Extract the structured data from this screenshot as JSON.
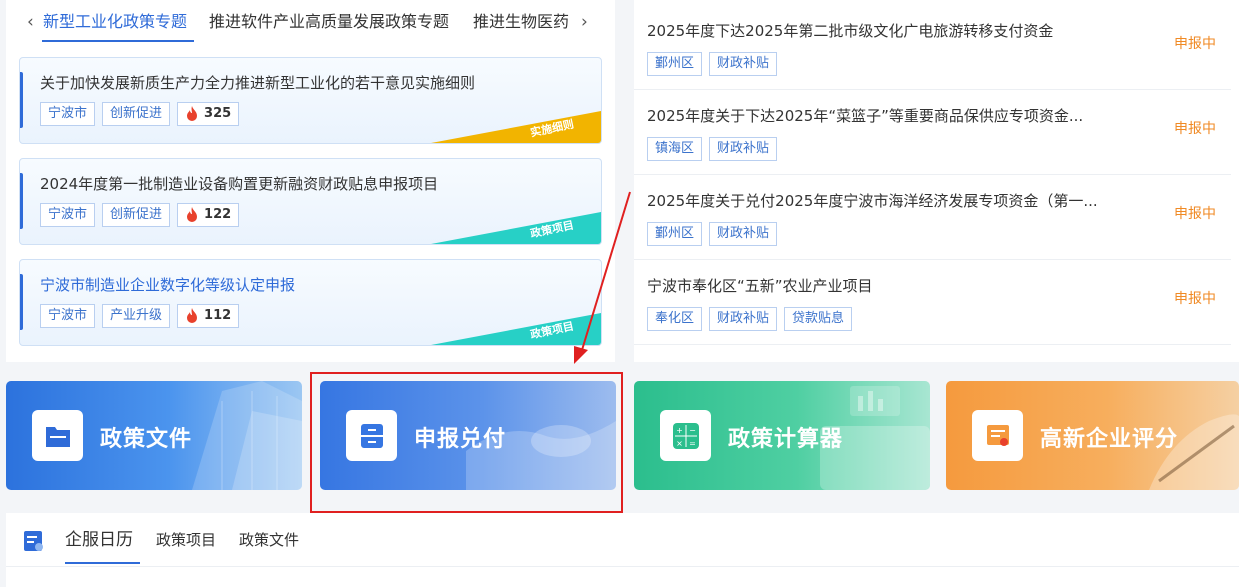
{
  "colors": {
    "brand_blue": "#2f6bd8",
    "status_orange": "#f08a24",
    "highlight_red": "#e02020",
    "ribbon_gold": "#f2b400",
    "ribbon_teal": "#27d0c6"
  },
  "policy_tabs": {
    "prev_icon": "chevron-left-icon",
    "next_icon": "chevron-right-icon",
    "items": [
      "新型工业化政策专题",
      "推进软件产业高质量发展政策专题",
      "推进生物医药"
    ],
    "prev": "‹",
    "next": "›"
  },
  "policy_cards": [
    {
      "title": "关于加快发展新质生产力全力推进新型工业化的若干意见实施细则",
      "tags": [
        "宁波市",
        "创新促进"
      ],
      "hot": "325",
      "ribbon": "实施细则"
    },
    {
      "title": "2024年度第一批制造业设备购置更新融资财政贴息申报项目",
      "tags": [
        "宁波市",
        "创新促进"
      ],
      "hot": "122",
      "ribbon": "政策项目"
    },
    {
      "title": "宁波市制造业企业数字化等级认定申报",
      "tags": [
        "宁波市",
        "产业升级"
      ],
      "hot": "112",
      "ribbon": "政策项目"
    }
  ],
  "fund_items": [
    {
      "title": "2025年度下达2025年第二批市级文化广电旅游转移支付资金",
      "tags": [
        "鄞州区",
        "财政补贴"
      ],
      "status": "申报中"
    },
    {
      "title": "2025年度关于下达2025年“菜篮子”等重要商品保供应专项资金...",
      "tags": [
        "镇海区",
        "财政补贴"
      ],
      "status": "申报中"
    },
    {
      "title": "2025年度关于兑付2025年度宁波市海洋经济发展专项资金（第一...",
      "tags": [
        "鄞州区",
        "财政补贴"
      ],
      "status": "申报中"
    },
    {
      "title": "宁波市奉化区“五新”农业产业项目",
      "tags": [
        "奉化区",
        "财政补贴",
        "贷款贴息"
      ],
      "status": "申报中"
    }
  ],
  "banners": [
    {
      "label": "政策文件",
      "icon": "folder-icon"
    },
    {
      "label": "申报兑付",
      "icon": "cabinet-icon"
    },
    {
      "label": "政策计算器",
      "icon": "calculator-icon"
    },
    {
      "label": "高新企业评分",
      "icon": "certificate-icon"
    }
  ],
  "calendar": {
    "icon": "calendar-icon",
    "tabs": [
      "企服日历",
      "政策项目",
      "政策文件"
    ]
  }
}
